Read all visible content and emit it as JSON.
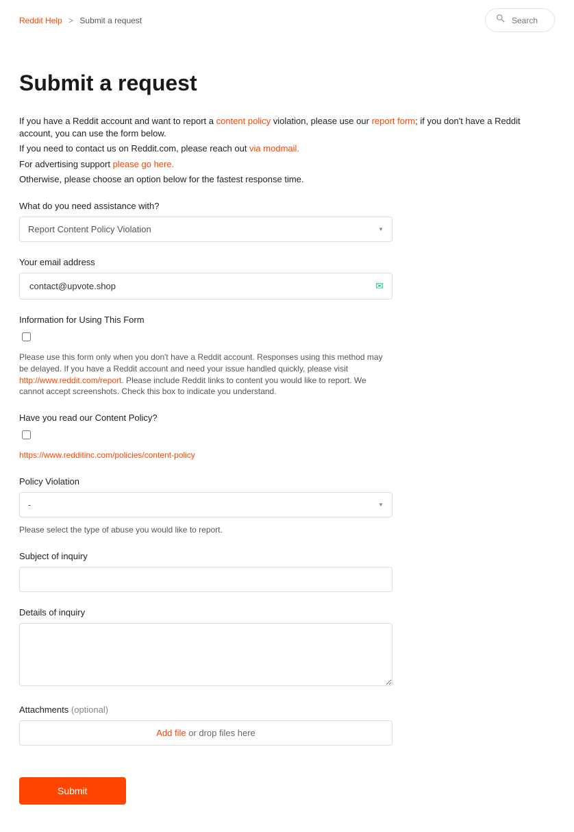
{
  "breadcrumb": {
    "home": "Reddit Help",
    "sep": ">",
    "current": "Submit a request"
  },
  "search": {
    "placeholder": "Search"
  },
  "title": "Submit a request",
  "intro": {
    "line1_a": "If you have a Reddit account and want to report a ",
    "line1_link1": "content policy",
    "line1_b": " violation, please use our ",
    "line1_link2": "report form",
    "line1_c": "; if you don't have a Reddit account, you can use the form below.",
    "line2_a": "If you need to contact us on Reddit.com, please reach out ",
    "line2_link": "via modmail.",
    "line3_a": "For advertising support ",
    "line3_link": "please go here.",
    "line4": "Otherwise, please choose an option below for the fastest response time."
  },
  "assistance": {
    "label": "What do you need assistance with?",
    "value": "Report Content Policy Violation"
  },
  "email": {
    "label": "Your email address",
    "value": "contact@upvote.shop"
  },
  "info_form": {
    "label": "Information for Using This Form",
    "hint_a": "Please use this form only when you don't have a Reddit account. Responses using this method may be delayed. If you have a Reddit account and need your issue handled quickly, please visit ",
    "hint_link": "http://www.reddit.com/report",
    "hint_b": ". Please include Reddit links to content you would like to report. We cannot accept screenshots. Check this box to indicate you understand."
  },
  "content_policy": {
    "label": "Have you read our Content Policy?",
    "link": "https://www.redditinc.com/policies/content-policy"
  },
  "policy_violation": {
    "label": "Policy Violation",
    "value": "-",
    "hint": "Please select the type of abuse you would like to report."
  },
  "subject": {
    "label": "Subject of inquiry",
    "value": ""
  },
  "details": {
    "label": "Details of inquiry",
    "value": ""
  },
  "attachments": {
    "label": "Attachments",
    "optional": "(optional)",
    "add_file": "Add file",
    "drop_text": " or drop files here"
  },
  "submit": {
    "label": "Submit"
  }
}
